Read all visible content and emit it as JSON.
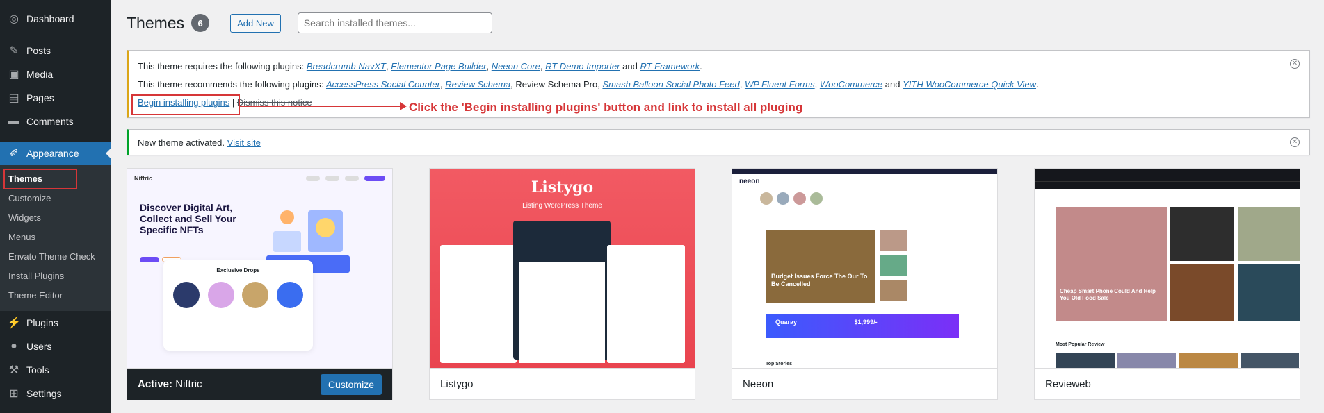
{
  "sidebar": {
    "items": [
      {
        "label": "Dashboard",
        "icon": "dashboard-icon",
        "glyph": "◎"
      },
      {
        "label": "Posts",
        "icon": "pushpin-icon",
        "glyph": "✎"
      },
      {
        "label": "Media",
        "icon": "media-icon",
        "glyph": "▣"
      },
      {
        "label": "Pages",
        "icon": "pages-icon",
        "glyph": "▤"
      },
      {
        "label": "Comments",
        "icon": "comments-icon",
        "glyph": "▬"
      },
      {
        "label": "Appearance",
        "icon": "paintbrush-icon",
        "glyph": "✐"
      },
      {
        "label": "Plugins",
        "icon": "plugin-icon",
        "glyph": "⚡"
      },
      {
        "label": "Users",
        "icon": "users-icon",
        "glyph": "●"
      },
      {
        "label": "Tools",
        "icon": "wrench-icon",
        "glyph": "⚒"
      },
      {
        "label": "Settings",
        "icon": "settings-icon",
        "glyph": "⊞"
      }
    ],
    "submenu": [
      "Themes",
      "Customize",
      "Widgets",
      "Menus",
      "Envato Theme Check",
      "Install Plugins",
      "Theme Editor"
    ]
  },
  "header": {
    "title": "Themes",
    "count": "6",
    "add_new": "Add New",
    "search_placeholder": "Search installed themes..."
  },
  "plugin_notice": {
    "requires_prefix": "This theme requires the following plugins:",
    "required": [
      "Breadcrumb NavXT",
      "Elementor Page Builder",
      "Neeon Core",
      "RT Demo Importer",
      "RT Framework"
    ],
    "recommends_prefix": "This theme recommends the following plugins:",
    "recommended": [
      "AccessPress Social Counter",
      "Review Schema",
      "Review Schema Pro",
      "Smash Balloon Social Photo Feed",
      "WP Fluent Forms",
      "WooCommerce",
      "YITH WooCommerce Quick View"
    ],
    "and_word": "and",
    "begin_installing": "Begin installing plugins",
    "separator": "|",
    "dismiss": "Dismiss this notice"
  },
  "annotation": "Click the 'Begin installing plugins' button and link to install all pluging",
  "activated_notice": {
    "text": "New theme activated.",
    "link": "Visit site"
  },
  "themes": [
    {
      "name": "Niftric",
      "active_label": "Active:",
      "button": "Customize",
      "mock_headline": "Discover Digital Art, Collect and Sell Your Specific NFTs",
      "mock_section": "Exclusive Drops"
    },
    {
      "name": "Listygo",
      "mock_logo": "Listygo",
      "mock_tagline": "Listing WordPress Theme"
    },
    {
      "name": "Neeon",
      "mock_logo": "neeon",
      "mock_headline": "Budget Issues Force The Our To Be Cancelled",
      "mock_banner": "Quaray",
      "mock_price": "$1,999/-",
      "mock_section": "Top Stories"
    },
    {
      "name": "Revieweb",
      "mock_headline": "Cheap Smart Phone Could And Help You Old Food Sale",
      "mock_section": "Most Popular Review"
    }
  ],
  "colors": {
    "sidebar_bg": "#1d2327",
    "accent": "#2271b1",
    "warning": "#dba617",
    "success": "#00a32a",
    "annotation": "#d63638"
  }
}
